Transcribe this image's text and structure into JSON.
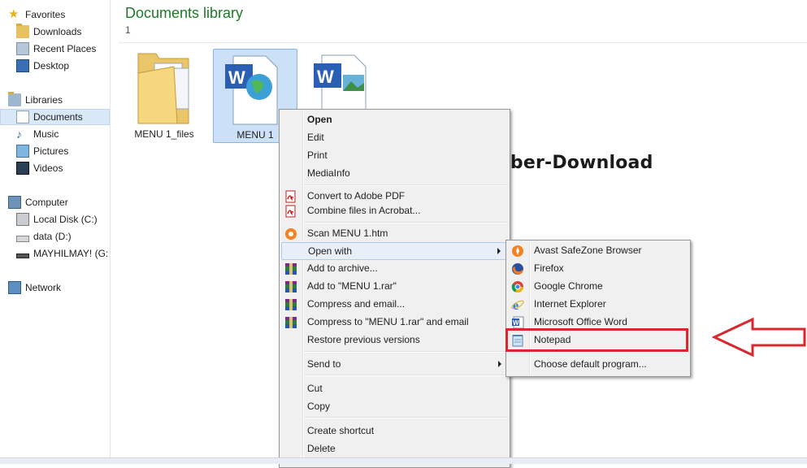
{
  "sidebar": {
    "favorites": "Favorites",
    "downloads": "Downloads",
    "recent": "Recent Places",
    "desktop": "Desktop",
    "libraries": "Libraries",
    "documents": "Documents",
    "music": "Music",
    "pictures": "Pictures",
    "videos": "Videos",
    "computer": "Computer",
    "local_disk": "Local Disk (C:)",
    "data": "data (D:)",
    "mayhilmay": "MAYHILMAY! (G:",
    "network": "Network"
  },
  "main": {
    "title": "Documents library",
    "subtitle": "1",
    "files": [
      {
        "label": "MENU 1_files"
      },
      {
        "label": "MENU 1"
      },
      {
        "label": ""
      }
    ]
  },
  "context_menu": {
    "items": [
      "Open",
      "Edit",
      "Print",
      "MediaInfo",
      "Convert to Adobe PDF",
      "Combine files in Acrobat...",
      "Scan MENU 1.htm",
      "Open with",
      "Add to archive...",
      "Add to \"MENU 1.rar\"",
      "Compress and email...",
      "Compress to \"MENU 1.rar\" and email",
      "Restore previous versions",
      "Send to",
      "Cut",
      "Copy",
      "Create shortcut",
      "Delete"
    ]
  },
  "open_with_menu": {
    "items": [
      "Avast SafeZone Browser",
      "Firefox",
      "Google Chrome",
      "Internet Explorer",
      "Microsoft Office Word",
      "Notepad",
      "Choose default program..."
    ]
  },
  "watermark": "MayCyber-Download",
  "colors": {
    "title_green": "#1e7a29",
    "highlight_red": "#d9272e",
    "watermark_orange": "#f05a24"
  }
}
